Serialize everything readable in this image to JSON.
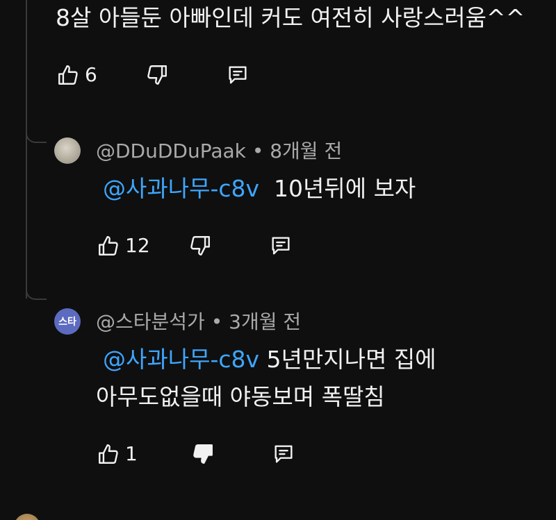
{
  "top_comment": {
    "text": "8살 아들둔 아빠인데 커도 여전히 사랑스러움^^",
    "like_count": "6"
  },
  "replies": [
    {
      "author": "@DDuDDuPaak",
      "time": "8개월 전",
      "mention": "@사과나무-c8v",
      "text_line1": "10년뒤에 보자",
      "like_count": "12"
    },
    {
      "author": "@스타분석가",
      "avatar_text": "스타",
      "time": "3개월 전",
      "mention": "@사과나무-c8v",
      "text_line1": "5년만지나면 집에",
      "text_line2": "아무도없을때 야동보며 폭딸침",
      "like_count": "1"
    }
  ],
  "icons": {
    "like": "thumbs-up-icon",
    "dislike": "thumbs-down-icon",
    "reply": "reply-comment-icon"
  },
  "colors": {
    "background": "#0f0f0f",
    "text": "#f1f1f1",
    "meta": "#aaaaaa",
    "mention": "#3ea6ff",
    "avatar_badge": "#5c6bc0"
  },
  "meta_separator": "•"
}
